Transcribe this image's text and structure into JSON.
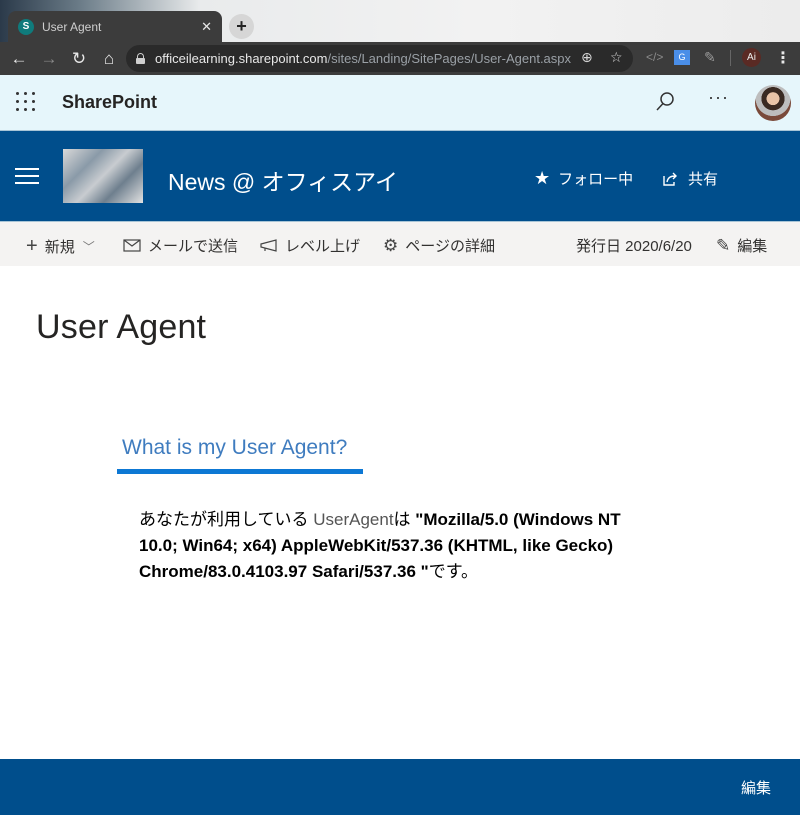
{
  "browser": {
    "tab_title": "User Agent",
    "tab_favicon_letter": "S",
    "url_host": "officeilearning.sharepoint.com",
    "url_path": "/sites/Landing/SitePages/User-Agent.aspx",
    "profile_initials": "Ai"
  },
  "suite_bar": {
    "brand": "SharePoint",
    "more_label": "···"
  },
  "site_header": {
    "title": "News @ オフィスアイ",
    "follow_label": "フォロー中",
    "share_label": "共有"
  },
  "command_bar": {
    "new_label": "新規",
    "email_label": "メールで送信",
    "promote_label": "レベル上げ",
    "page_details_label": "ページの詳細",
    "published_label": "発行日 2020/6/20",
    "edit_label": "編集"
  },
  "page": {
    "title": "User Agent",
    "section_heading": "What is my User Agent?",
    "ua_prefix": "あなたが利用している ",
    "ua_word": "UserAgent",
    "ua_particle": "は ",
    "ua_value": "\"Mozilla/5.0 (Windows NT 10.0; Win64; x64) AppleWebKit/537.36 (KHTML, like Gecko) Chrome/83.0.4103.97 Safari/537.36 \"",
    "ua_suffix": "です。"
  },
  "footer": {
    "edit_label": "編集"
  },
  "colors": {
    "brand_blue": "#004e8c",
    "accent_blue": "#0d78d4",
    "suite_bar_bg": "#e6f6fb"
  }
}
